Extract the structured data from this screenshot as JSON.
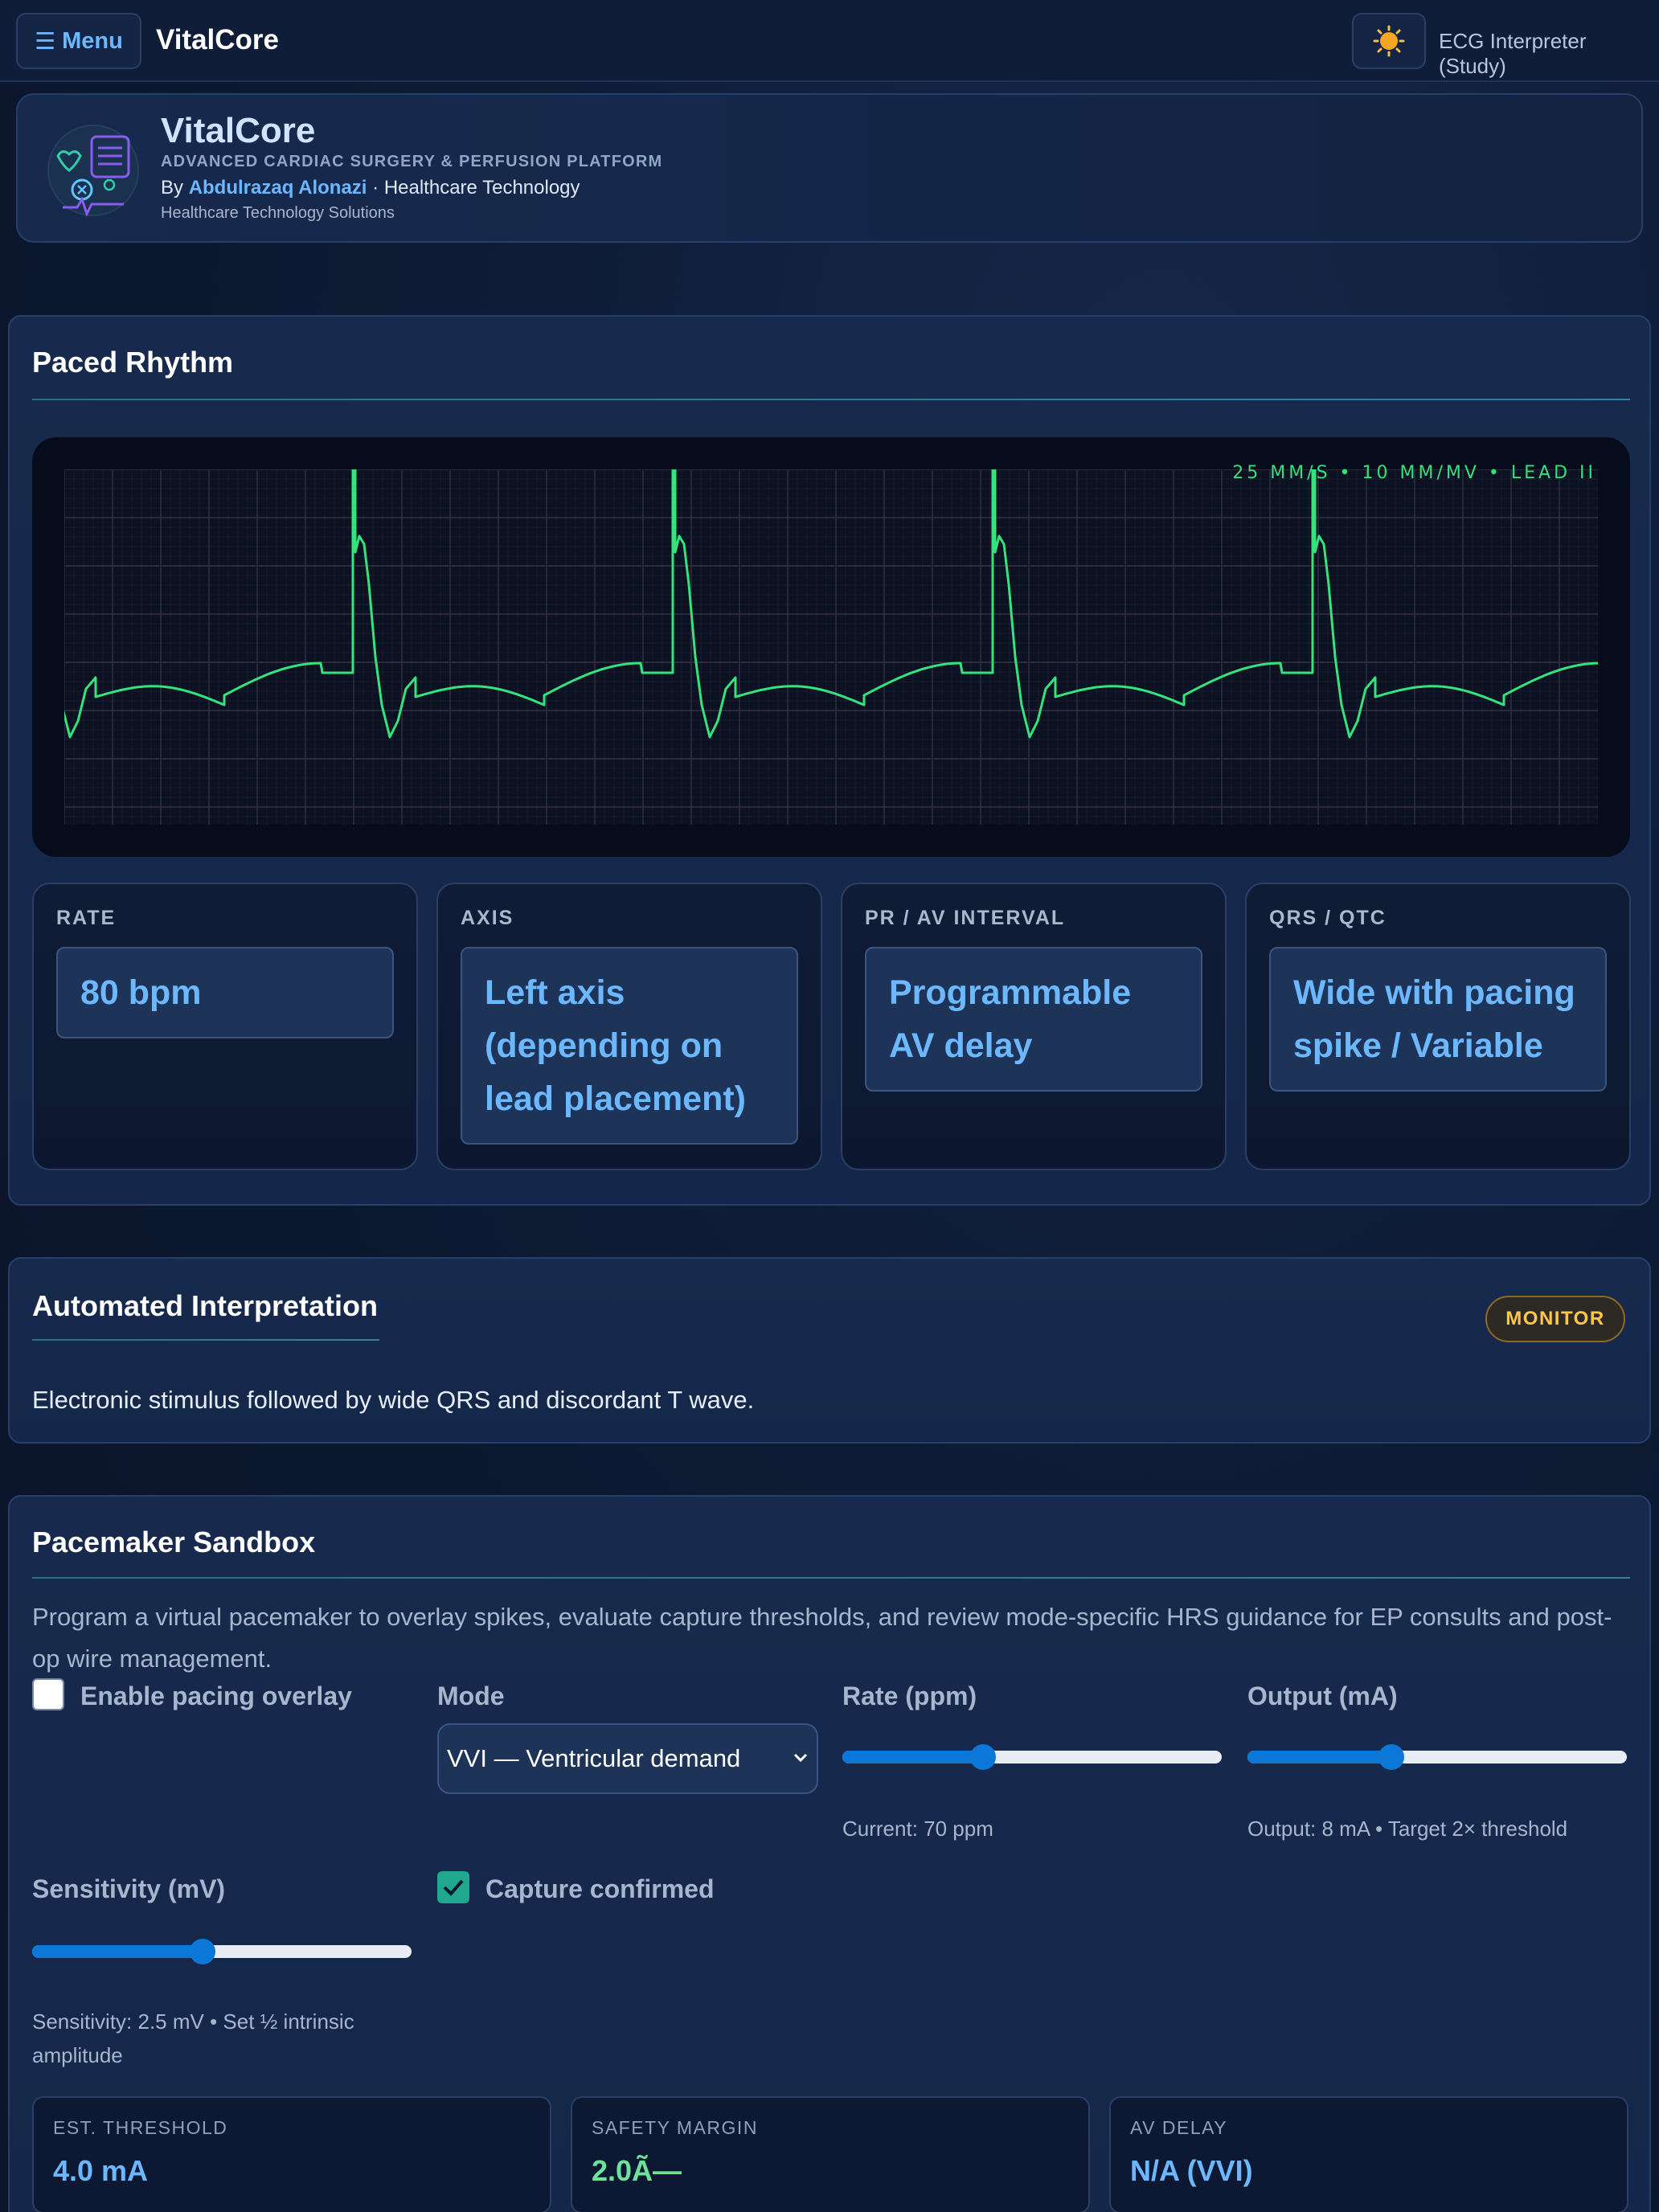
{
  "topbar": {
    "menu_label": "Menu",
    "brand": "VitalCore",
    "right_label": "ECG Interpreter (Study)",
    "theme_icon": "sun-icon"
  },
  "header": {
    "title": "VitalCore",
    "subtitle": "ADVANCED CARDIAC SURGERY & PERFUSION PLATFORM",
    "by_prefix": "By",
    "author": "Abdulrazaq Alonazi",
    "by_suffix": "· Healthcare Technology",
    "tagline": "Healthcare Technology Solutions"
  },
  "rhythm": {
    "title": "Paced Rhythm",
    "ecg_caption": "25 MM/S • 10 MM/MV • LEAD II",
    "trace_color": "#34e37c"
  },
  "metrics": [
    {
      "label": "RATE",
      "value": "80 bpm"
    },
    {
      "label": "AXIS",
      "value": "Left axis (depending on lead placement)"
    },
    {
      "label": "PR / AV INTERVAL",
      "value": "Programmable AV delay"
    },
    {
      "label": "QRS / QTC",
      "value": "Wide with pacing spike / Variable"
    }
  ],
  "interpretation": {
    "title": "Automated Interpretation",
    "badge": "MONITOR",
    "text": "Electronic stimulus followed by wide QRS and discordant T wave."
  },
  "pacemaker": {
    "title": "Pacemaker Sandbox",
    "description": "Program a virtual pacemaker to overlay spikes, evaluate capture thresholds, and review mode-specific HRS guidance for EP consults and post-op wire management.",
    "enable_overlay_label": "Enable pacing overlay",
    "enable_overlay_checked": false,
    "mode_label": "Mode",
    "mode_value": "VVI — Ventricular demand",
    "rate_label": "Rate (ppm)",
    "rate_fraction": 0.37,
    "rate_help": "Current: 70 ppm",
    "output_label": "Output (mA)",
    "output_fraction": 0.38,
    "output_help": "Output: 8 mA • Target 2× threshold",
    "sensitivity_label": "Sensitivity (mV)",
    "sensitivity_fraction": 0.45,
    "sensitivity_help": "Sensitivity: 2.5 mV • Set ½ intrinsic amplitude",
    "capture_label": "Capture confirmed",
    "capture_checked": true,
    "stats": [
      {
        "label": "EST. THRESHOLD",
        "value": "4.0 mA",
        "color": "#6cb8ff"
      },
      {
        "label": "SAFETY MARGIN",
        "value": "2.0Ã—",
        "color": "#6ee29a"
      },
      {
        "label": "AV DELAY",
        "value": "N/A (VVI)",
        "color": "#6cb8ff"
      }
    ]
  }
}
